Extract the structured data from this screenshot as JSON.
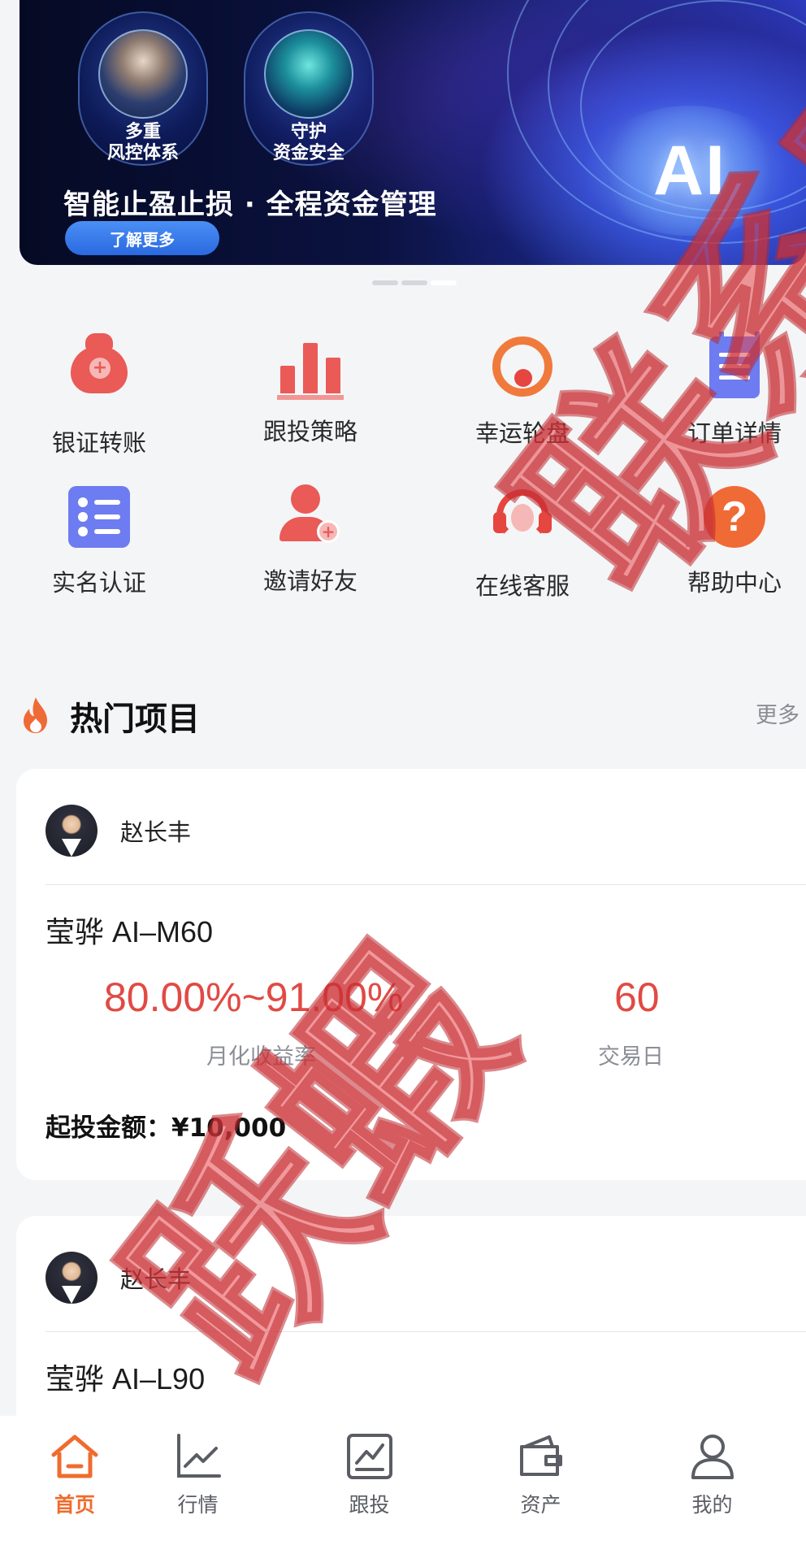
{
  "banner": {
    "badges": [
      {
        "label": "多重\n风控体系"
      },
      {
        "label": "守护\n资金安全"
      }
    ],
    "ai_label": "AI",
    "slogan": "智能止盈止损 · 全程资金管理",
    "button_label": "了解更多",
    "carousel": {
      "count": 3,
      "active_index": 2
    }
  },
  "quick_actions": [
    {
      "label": "银证转账",
      "icon": "money-bag-icon",
      "color": "#ea5a57"
    },
    {
      "label": "跟投策略",
      "icon": "bar-chart-icon",
      "color": "#ea5a57"
    },
    {
      "label": "幸运轮盘",
      "icon": "wheel-icon",
      "color": "#f07a3c"
    },
    {
      "label": "订单详情",
      "icon": "clipboard-icon",
      "color": "#6d7cf0"
    },
    {
      "label": "实名认证",
      "icon": "checklist-icon",
      "color": "#6d7cf0"
    },
    {
      "label": "邀请好友",
      "icon": "add-user-icon",
      "color": "#ea5a57"
    },
    {
      "label": "在线客服",
      "icon": "headset-icon",
      "color": "#e54640"
    },
    {
      "label": "帮助中心",
      "icon": "help-icon",
      "color": "#f06a35"
    }
  ],
  "hot_section": {
    "title": "热门项目",
    "more_label": "更多",
    "icon": "fire-icon"
  },
  "projects": [
    {
      "manager": "赵长丰",
      "name": "莹骅 AI–M60",
      "monthly_return": "80.00%~91.00%",
      "monthly_return_label": "月化收益率",
      "trading_days": "60",
      "trading_days_label": "交易日",
      "min_invest_label": "起投金额：",
      "min_invest_value": "¥10,000"
    },
    {
      "manager": "赵长丰",
      "name": "莹骅 AI–L90"
    }
  ],
  "watermark": {
    "line1": "联系官网",
    "line2": "跃蝦"
  },
  "tabbar": [
    {
      "label": "首页",
      "icon": "home-icon",
      "active": true
    },
    {
      "label": "行情",
      "icon": "line-chart-icon",
      "active": false
    },
    {
      "label": "跟投",
      "icon": "trend-doc-icon",
      "active": false
    },
    {
      "label": "资产",
      "icon": "wallet-icon",
      "active": false
    },
    {
      "label": "我的",
      "icon": "profile-icon",
      "active": false
    }
  ],
  "colors": {
    "accent": "#ef6c2e",
    "highlight": "#e14a44",
    "watermark": "#e6464b"
  }
}
